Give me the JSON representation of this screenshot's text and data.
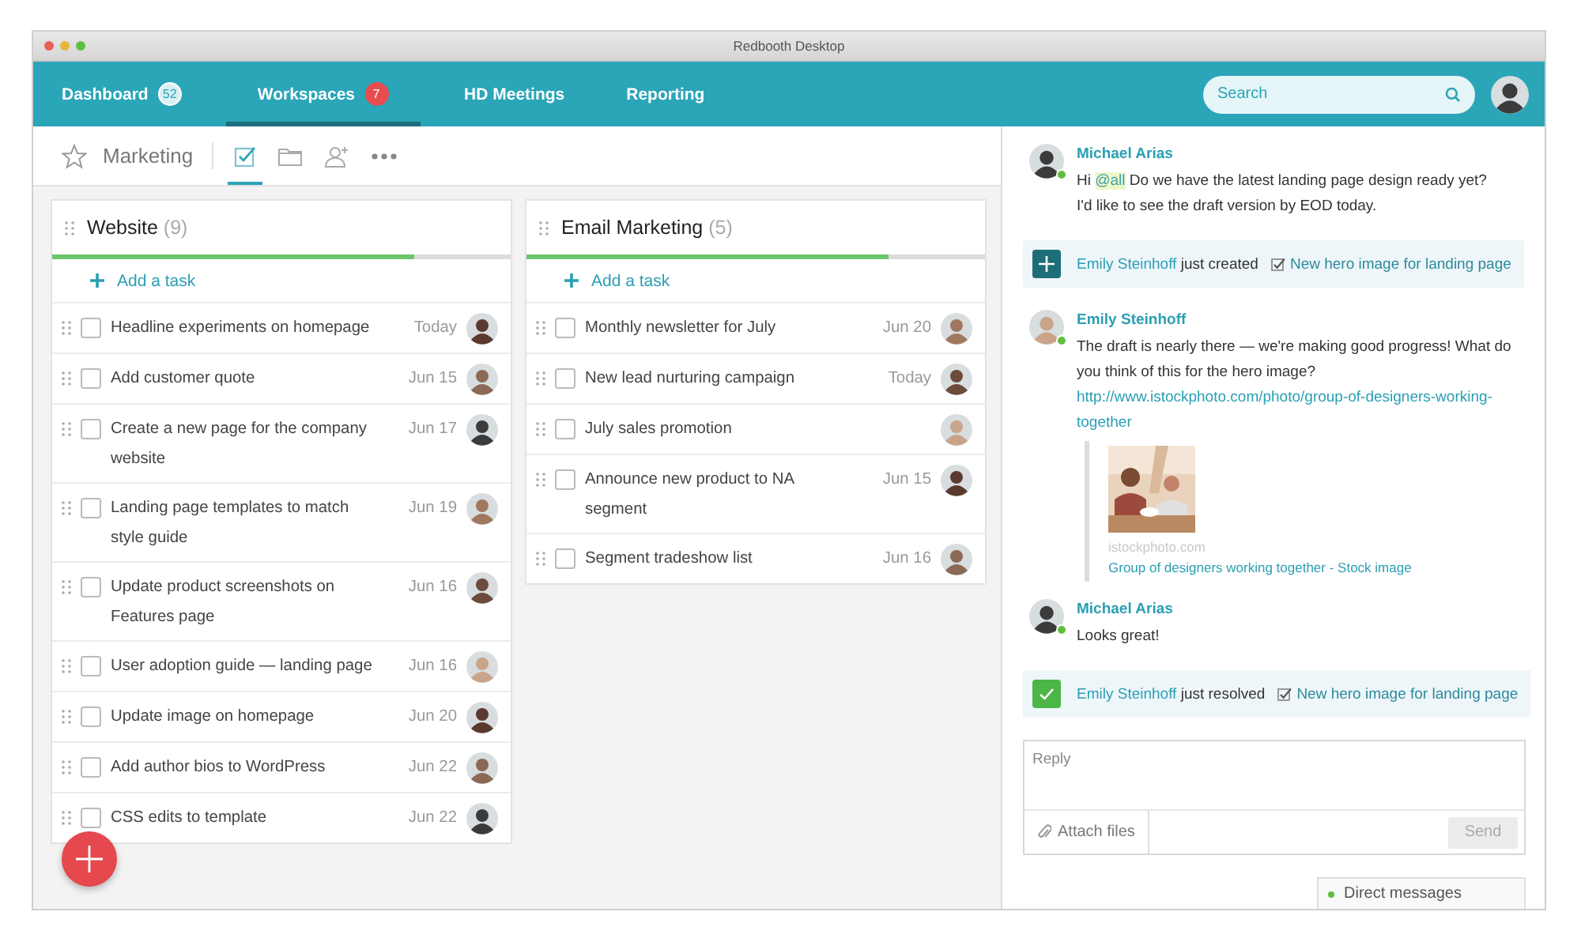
{
  "window": {
    "title": "Redbooth Desktop"
  },
  "nav": {
    "tabs": [
      {
        "label": "Dashboard",
        "badge": "52",
        "kind": "count",
        "selected": false
      },
      {
        "label": "Workspaces",
        "badge": "7",
        "kind": "alert",
        "selected": true
      },
      {
        "label": "HD Meetings",
        "selected": false
      },
      {
        "label": "Reporting",
        "selected": false
      }
    ],
    "search": {
      "placeholder": "Search"
    }
  },
  "workspace": {
    "title": "Marketing",
    "starred": false,
    "views": [
      {
        "kind": "tasks",
        "selected": true
      },
      {
        "kind": "files",
        "selected": false
      },
      {
        "kind": "people",
        "selected": false
      },
      {
        "kind": "more",
        "selected": false
      }
    ]
  },
  "columns": [
    {
      "title": "Website",
      "count": "(9)",
      "level": 0.79,
      "add_label": "Add a task",
      "tasks": [
        {
          "title": "Headline experiments on homepage",
          "date": "Today",
          "checked": false
        },
        {
          "title": "Add customer quote",
          "date": "Jun 15",
          "checked": false
        },
        {
          "title": "Create a new page for the company website",
          "date": "Jun 17",
          "checked": false
        },
        {
          "title": "Landing page templates to match style guide",
          "date": "Jun 19",
          "checked": false
        },
        {
          "title": "Update product screenshots on Features page",
          "date": "Jun 16",
          "checked": false
        },
        {
          "title": "User adoption guide — landing page",
          "date": "Jun 16",
          "checked": false
        },
        {
          "title": "Update image on homepage",
          "date": "Jun 20",
          "checked": false
        },
        {
          "title": "Add author bios to WordPress",
          "date": "Jun 22",
          "checked": false
        },
        {
          "title": "CSS edits to template",
          "date": "Jun 22",
          "checked": false
        }
      ]
    },
    {
      "title": "Email Marketing",
      "count": "(5)",
      "level": 0.79,
      "add_label": "Add a task",
      "tasks": [
        {
          "title": "Monthly newsletter for July",
          "date": "Jun 20",
          "checked": false
        },
        {
          "title": "New lead nurturing campaign",
          "date": "Today",
          "checked": false
        },
        {
          "title": "July sales promotion",
          "checked": false
        },
        {
          "title": "Announce new product to NA segment",
          "date": "Jun 15",
          "checked": false
        },
        {
          "title": "Segment tradeshow list",
          "date": "Jun 16",
          "checked": false
        }
      ]
    }
  ],
  "chat": {
    "items": [
      {
        "kind": "message",
        "author": "Michael Arias",
        "online": true,
        "body": [
          {
            "kind": "text",
            "text": "Hi "
          },
          {
            "kind": "mention",
            "text": "@all"
          },
          {
            "kind": "text",
            "text": " Do we have the latest landing page design ready yet?\nI'd like to see the draft version by EOD today."
          }
        ]
      },
      {
        "kind": "created",
        "user": "Emily Steinhoff",
        "action": "just created",
        "task": "New hero image for landing page"
      },
      {
        "kind": "message",
        "author": "Emily Steinhoff",
        "online": true,
        "body": [
          {
            "kind": "text",
            "text": "The draft is nearly there — we're making good progress! What do you think of this for the hero image? "
          },
          {
            "kind": "link",
            "text": "http://www.istockphoto.com/photo/group-of-designers-working-together"
          }
        ],
        "attachment": {
          "kind": "picture",
          "source": "istockphoto.com",
          "title": "Group of designers working together - Stock image"
        }
      },
      {
        "kind": "message",
        "author": "Michael Arias",
        "online": true,
        "body": [
          {
            "kind": "text",
            "text": "Looks great!"
          }
        ]
      },
      {
        "kind": "resolved",
        "user": "Emily Steinhoff",
        "action": "just resolved",
        "task": "New hero image for landing page"
      }
    ],
    "reply": {
      "placeholder": "Reply",
      "attach_label": "Attach files",
      "send_label": "Send",
      "send_disabled": true
    },
    "direct_messages": {
      "label": "Direct messages",
      "online": true
    }
  }
}
